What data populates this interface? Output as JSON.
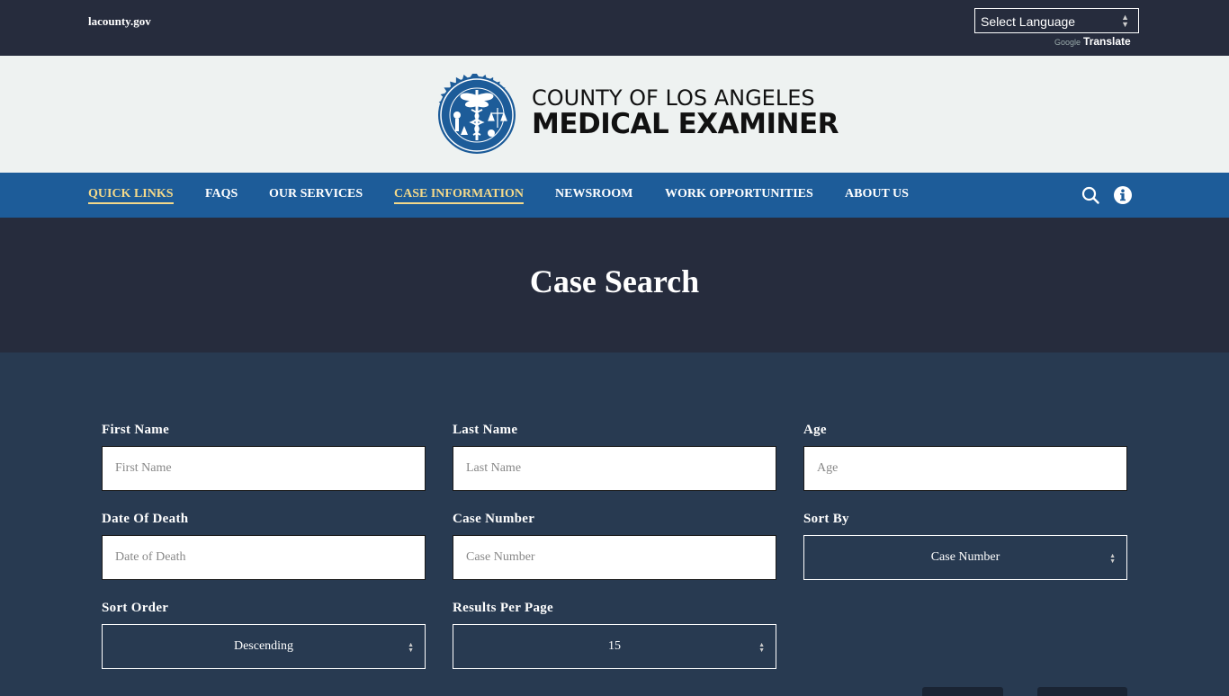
{
  "topbar": {
    "gov_link": "lacounty.gov",
    "language_select": "Select Language",
    "google_label": "Google",
    "translate_label": "Translate"
  },
  "brand": {
    "line1": "COUNTY OF LOS ANGELES",
    "line2": "MEDICAL EXAMINER",
    "seal_outer_top": "DEPARTMENT OF MEDICAL EXAMINER",
    "seal_outer_bottom": "COUNTY OF LOS ANGELES"
  },
  "nav": {
    "items": [
      {
        "label": "QUICK LINKS",
        "active": true
      },
      {
        "label": "FAQS",
        "active": false
      },
      {
        "label": "OUR SERVICES",
        "active": false
      },
      {
        "label": "CASE INFORMATION",
        "active": true
      },
      {
        "label": "NEWSROOM",
        "active": false
      },
      {
        "label": "WORK OPPORTUNITIES",
        "active": false
      },
      {
        "label": "ABOUT US",
        "active": false
      }
    ],
    "search_icon": "search-icon",
    "info_icon": "info-icon"
  },
  "hero": {
    "title": "Case Search"
  },
  "form": {
    "first_name": {
      "label": "First Name",
      "placeholder": "First Name",
      "value": ""
    },
    "last_name": {
      "label": "Last Name",
      "placeholder": "Last Name",
      "value": ""
    },
    "age": {
      "label": "Age",
      "placeholder": "Age",
      "value": ""
    },
    "date_of_death": {
      "label": "Date Of Death",
      "placeholder": "Date of Death",
      "value": ""
    },
    "case_number": {
      "label": "Case Number",
      "placeholder": "Case Number",
      "value": ""
    },
    "sort_by": {
      "label": "Sort By",
      "selected": "Case Number"
    },
    "sort_order": {
      "label": "Sort Order",
      "selected": "Descending"
    },
    "results_per_page": {
      "label": "Results Per Page",
      "selected": "15"
    }
  },
  "colors": {
    "dark": "#262c3d",
    "nav_blue": "#1d5c99",
    "form_bg": "#283a51",
    "accent_gold": "#f4d98a"
  }
}
